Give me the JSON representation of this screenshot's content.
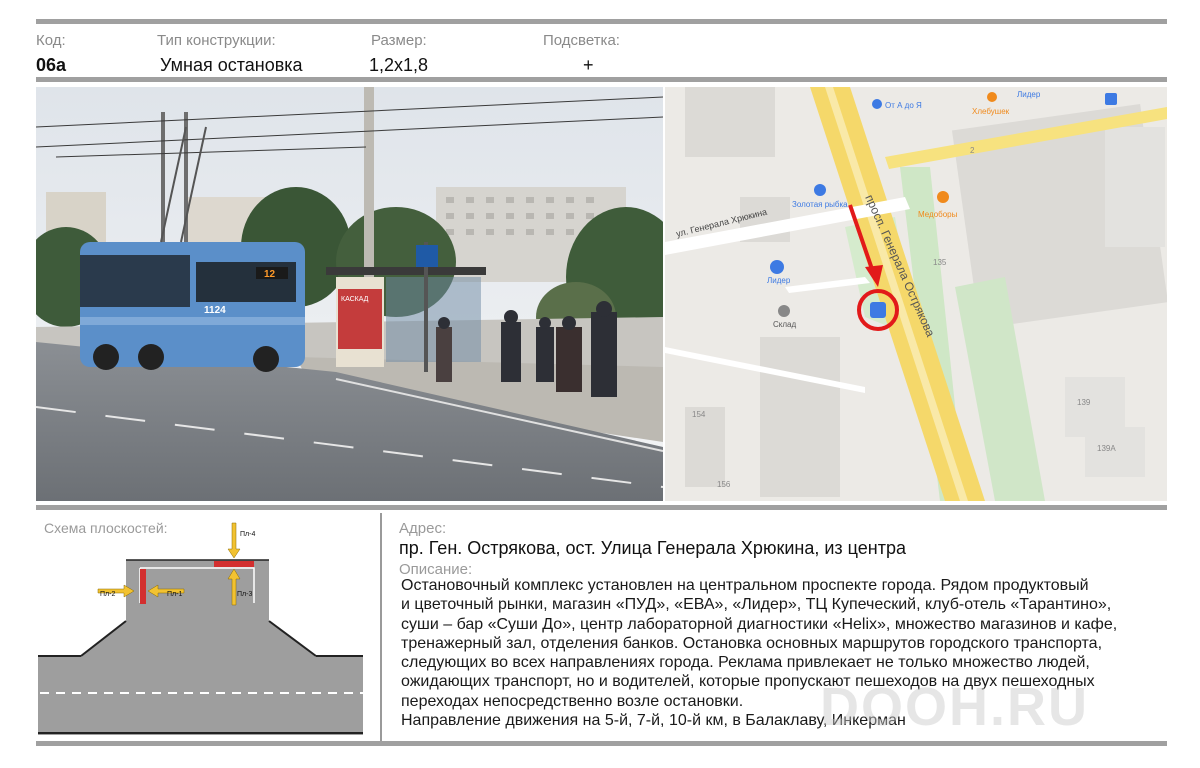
{
  "header": {
    "code_label": "Код:",
    "code_value": "06а",
    "type_label": "Тип конструкции:",
    "type_value": "Умная остановка",
    "size_label": "Размер:",
    "size_value": "1,2x1,8",
    "light_label": "Подсветка:",
    "light_value": "+"
  },
  "photo": {
    "bus_number": "1124",
    "route_number": "12",
    "ad_title": "КАСКАД"
  },
  "map": {
    "street_main": "просп. Генерала Острякова",
    "street_side": "ул. Генерала Хрюкина",
    "pois": [
      "От А до Я",
      "Хлебушек",
      "Лидер",
      "Золотая рыбка",
      "Медоборы",
      "Лидер",
      "Склад"
    ],
    "house_numbers": [
      "2",
      "135",
      "154",
      "156",
      "139",
      "139А"
    ]
  },
  "scheme": {
    "title": "Схема плоскостей:",
    "planes": [
      "Пл-1",
      "Пл-2",
      "Пл-3",
      "Пл-4"
    ]
  },
  "address": {
    "label": "Адрес:",
    "value": "пр. Ген. Острякова, ост. Улица Генерала Хрюкина, из центра"
  },
  "description": {
    "label": "Описание:",
    "lines": [
      "Остановочный комплекс установлен на центральном проспекте города. Рядом  продуктовый",
      "и цветочный рынки, магазин «ПУД»,  «ЕВА», «Лидер», ТЦ Купеческий, клуб-отель «Тарантино»,",
      "суши – бар «Суши До», центр лабораторной диагностики «Helix», множество магазинов и кафе,",
      "тренажерный зал, отделения банков. Остановка основных маршрутов городского транспорта,",
      "следующих во всех направлениях города. Реклама привлекает не только множество людей,",
      "ожидающих транспорт, но и водителей, которые пропускают пешеходов на двух пешеходных",
      "переходах непосредственно возле остановки.",
      "Направление движения на 5-й, 7-й, 10-й км, в Балаклаву, Инкерман"
    ]
  },
  "watermark": "DOOH.RU",
  "colors": {
    "rule": "#a0a0a0",
    "panel_red": "#d32f2f",
    "arrow_yellow": "#f2c231",
    "road_gray": "#9e9e9e"
  }
}
